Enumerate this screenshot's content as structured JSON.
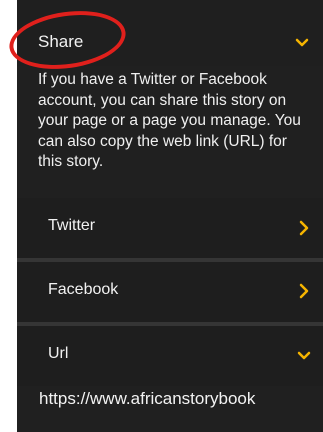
{
  "share": {
    "title": "Share",
    "description": "If you have a Twitter or Facebook account, you can share this story on your page or a page you manage. You can also copy the web link (URL) for this story.",
    "expand_icon": "chevron-down-icon"
  },
  "options": [
    {
      "label": "Twitter",
      "icon": "chevron-right-icon"
    },
    {
      "label": "Facebook",
      "icon": "chevron-right-icon"
    },
    {
      "label": "Url",
      "icon": "chevron-down-icon"
    }
  ],
  "url_value": "https://www.africanstorybook",
  "colors": {
    "panel_bg": "#202020",
    "accent": "#f5b400",
    "annotation": "#e0201c",
    "text": "#f2f2f2"
  }
}
